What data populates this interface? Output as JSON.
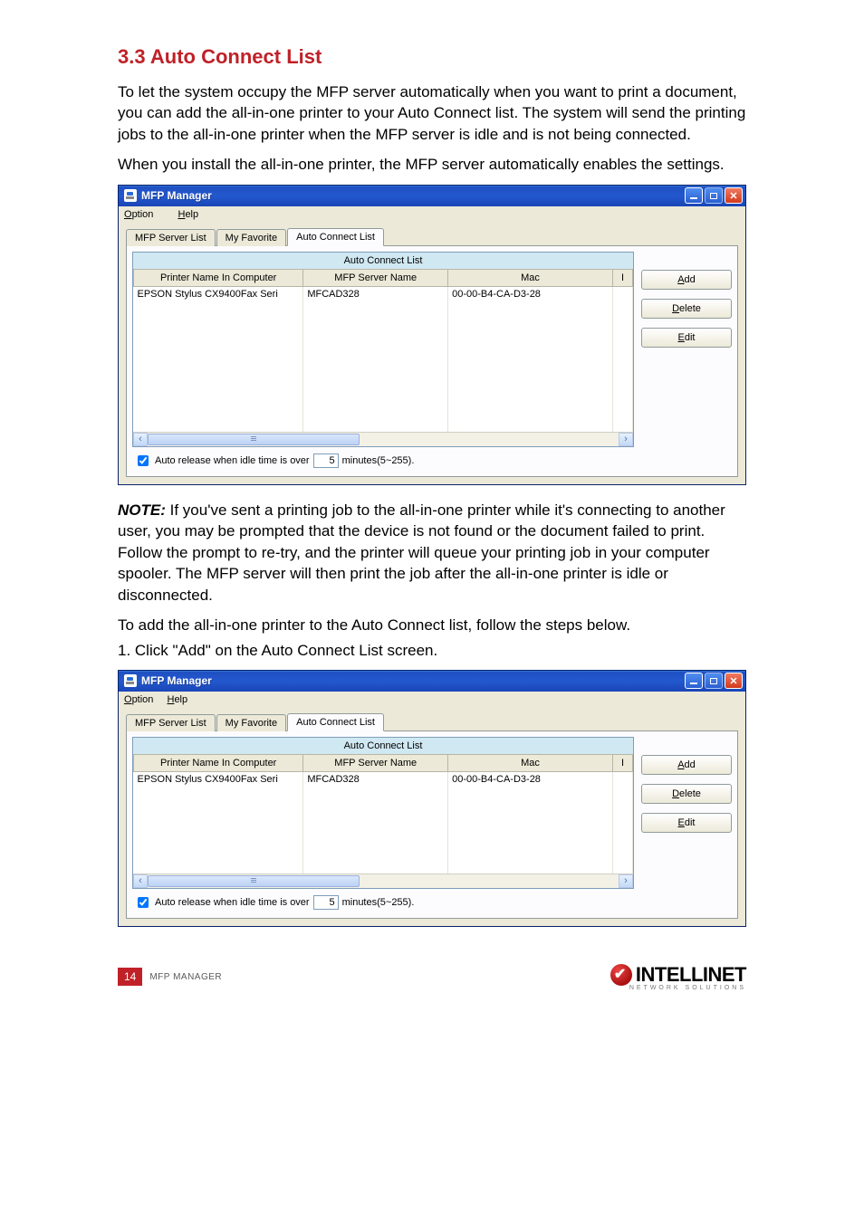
{
  "heading": "3.3  Auto Connect List",
  "para1": "To let the system occupy the MFP server automatically when you want to print a document, you can add the all-in-one printer to your Auto Connect list. The system will send the printing jobs to the all-in-one printer when the MFP server is idle and is not being connected.",
  "para2": "When you install the all-in-one printer, the MFP server automatically enables the settings.",
  "noteLabel": "NOTE:",
  "noteText": " If you've sent a printing job to the all-in-one printer while it's connecting to another user, you may be prompted that the device is not found or the document failed to print. Follow the prompt to re-try, and the printer will queue your printing job in your computer spooler. The MFP server will then print the job after the all-in-one printer is idle or disconnected.",
  "para3": "To add the all-in-one printer to the Auto Connect list, follow the steps below.",
  "step1": "1. Click \"Add\" on the Auto Connect List screen.",
  "window": {
    "title": "MFP Manager",
    "menu": {
      "option": "Option",
      "help": "Help"
    },
    "tabs": {
      "server": "MFP Server List",
      "fav": "My Favorite",
      "auto": "Auto Connect List"
    },
    "listTitle": "Auto Connect List",
    "columns": {
      "printer": "Printer Name In Computer",
      "server": "MFP Server Name",
      "mac": "Mac",
      "ip": "I"
    },
    "row": {
      "printer": "EPSON Stylus CX9400Fax Seri",
      "server": "MFCAD328",
      "mac": "00-00-B4-CA-D3-28"
    },
    "buttons": {
      "add": "Add",
      "delete": "Delete",
      "edit": "Edit"
    },
    "autoRelease": {
      "label": "Auto release when idle time is over",
      "value": "5",
      "suffix": "minutes(5~255)."
    }
  },
  "footer": {
    "pageNum": "14",
    "section": "MFP MANAGER",
    "brand": "INTELLINET",
    "tagline": "NETWORK SOLUTIONS"
  }
}
